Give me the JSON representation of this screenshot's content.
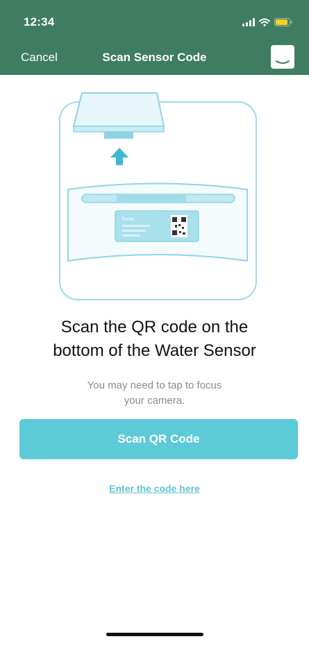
{
  "status_bar": {
    "time": "12:34",
    "icons": [
      "signal-icon",
      "wifi-icon",
      "battery-icon"
    ],
    "battery_color": "#f5d21e"
  },
  "nav": {
    "cancel_label": "Cancel",
    "title": "Scan Sensor Code",
    "right_icon": "chat-icon"
  },
  "illustration": {
    "icon": "water-sensor-illustration",
    "label_brand": "flume"
  },
  "content": {
    "headline_line1": "Scan the QR code on the",
    "headline_line2": "bottom of the Water Sensor",
    "subtext_line1": "You may need to tap to focus",
    "subtext_line2": "your camera."
  },
  "actions": {
    "scan_button_label": "Scan QR Code",
    "enter_code_link": "Enter the code here"
  },
  "colors": {
    "header_bg": "#3f7d62",
    "accent": "#5dcad8",
    "link": "#5dc3d6",
    "illustration_stroke": "#8fd3e3"
  }
}
